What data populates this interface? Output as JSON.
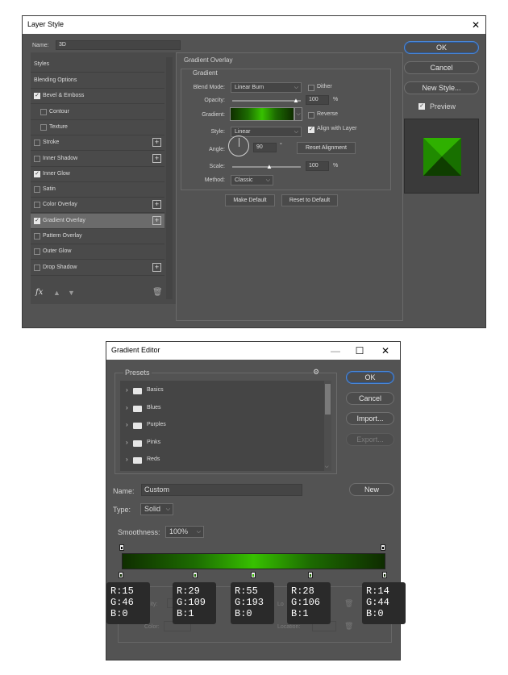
{
  "layer_style": {
    "title": "Layer Style",
    "name_label": "Name:",
    "name_value": "3D",
    "styles_header": "Styles",
    "items": [
      {
        "label": "Blending Options",
        "checkbox": false,
        "checked": false,
        "plus": false,
        "indent": false
      },
      {
        "label": "Bevel & Emboss",
        "checkbox": true,
        "checked": true,
        "plus": false,
        "indent": false
      },
      {
        "label": "Contour",
        "checkbox": true,
        "checked": false,
        "plus": false,
        "indent": true
      },
      {
        "label": "Texture",
        "checkbox": true,
        "checked": false,
        "plus": false,
        "indent": true
      },
      {
        "label": "Stroke",
        "checkbox": true,
        "checked": false,
        "plus": true,
        "indent": false
      },
      {
        "label": "Inner Shadow",
        "checkbox": true,
        "checked": false,
        "plus": true,
        "indent": false
      },
      {
        "label": "Inner Glow",
        "checkbox": true,
        "checked": true,
        "plus": false,
        "indent": false
      },
      {
        "label": "Satin",
        "checkbox": true,
        "checked": false,
        "plus": false,
        "indent": false
      },
      {
        "label": "Color Overlay",
        "checkbox": true,
        "checked": false,
        "plus": true,
        "indent": false
      },
      {
        "label": "Gradient Overlay",
        "checkbox": true,
        "checked": true,
        "plus": true,
        "indent": false,
        "selected": true
      },
      {
        "label": "Pattern Overlay",
        "checkbox": true,
        "checked": false,
        "plus": false,
        "indent": false
      },
      {
        "label": "Outer Glow",
        "checkbox": true,
        "checked": false,
        "plus": false,
        "indent": false
      },
      {
        "label": "Drop Shadow",
        "checkbox": true,
        "checked": false,
        "plus": true,
        "indent": false
      }
    ],
    "footer_icons": [
      "fx-icon",
      "move-up-icon",
      "move-down-icon",
      "trash-icon"
    ],
    "fx_label": "fx",
    "panel_title": "Gradient Overlay",
    "section_title": "Gradient",
    "blend_mode_label": "Blend Mode:",
    "blend_mode_value": "Linear Burn",
    "dither_label": "Dither",
    "dither_checked": false,
    "opacity_label": "Opacity:",
    "opacity_value": "100",
    "percent": "%",
    "gradient_label": "Gradient:",
    "reverse_label": "Reverse",
    "reverse_checked": false,
    "style_label": "Style:",
    "style_value": "Linear",
    "align_label": "Align with Layer",
    "align_checked": true,
    "angle_label": "Angle:",
    "angle_value": "90",
    "degree": "°",
    "reset_alignment": "Reset Alignment",
    "scale_label": "Scale:",
    "scale_value": "100",
    "method_label": "Method:",
    "method_value": "Classic",
    "make_default": "Make Default",
    "reset_default": "Reset to Default",
    "ok": "OK",
    "cancel": "Cancel",
    "new_style": "New Style...",
    "preview_label": "Preview",
    "preview_checked": true
  },
  "gradient_editor": {
    "title": "Gradient Editor",
    "presets_label": "Presets",
    "folders": [
      "Basics",
      "Blues",
      "Purples",
      "Pinks",
      "Reds"
    ],
    "ok": "OK",
    "cancel": "Cancel",
    "import": "Import...",
    "export": "Export...",
    "name_label": "Name:",
    "name_value": "Custom",
    "new_button": "New",
    "type_label": "Type:",
    "type_value": "Solid",
    "smoothness_label": "Smoothness:",
    "smoothness_value": "100%",
    "stops_partial_label": "s",
    "opacity_partial": "acity:",
    "location_partial": "Lo",
    "color_label": "Color:",
    "location_label": "Location:",
    "color_stops": [
      {
        "r": "R:15",
        "g": "G:46",
        "b": "B:0",
        "hex": "#0f2e00",
        "pos": 0
      },
      {
        "r": "R:29",
        "g": "G:109",
        "b": "B:1",
        "hex": "#1d6d01",
        "pos": 28
      },
      {
        "r": "R:55",
        "g": "G:193",
        "b": "B:0",
        "hex": "#37c100",
        "pos": 50
      },
      {
        "r": "R:28",
        "g": "G:106",
        "b": "B:1",
        "hex": "#1c6a01",
        "pos": 72
      },
      {
        "r": "R:14",
        "g": "G:44",
        "b": "B:0",
        "hex": "#0e2c00",
        "pos": 100
      }
    ]
  },
  "colors": {
    "dialog_bg": "#535353",
    "accent_blue": "#4a87d8",
    "gradient_dark": "#0f2e00",
    "gradient_bright": "#37c100"
  }
}
